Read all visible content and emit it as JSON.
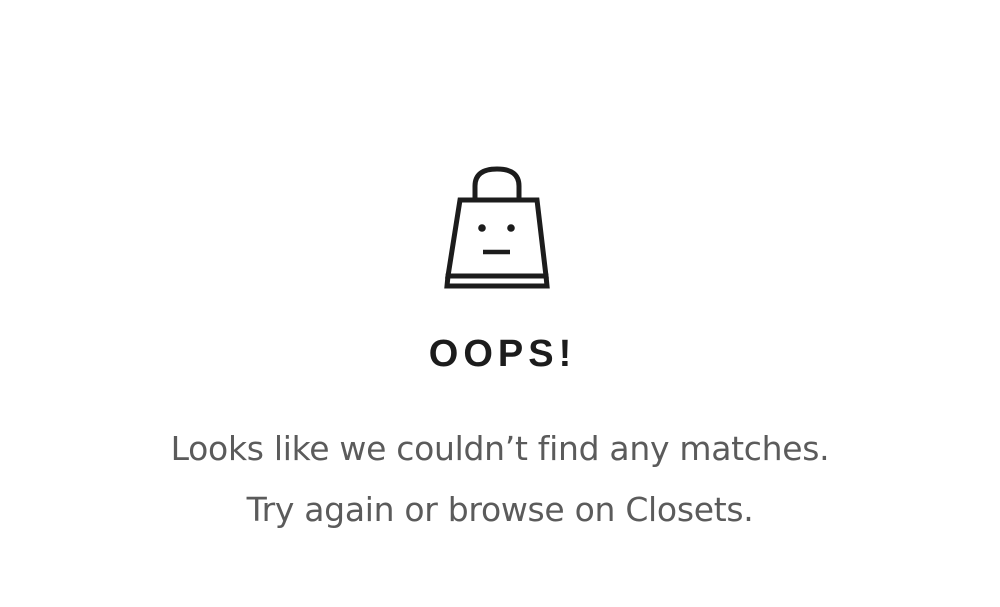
{
  "empty_state": {
    "icon": "shopping-bag-face-icon",
    "title": "OOPS!",
    "message_line1": "Looks like we couldn’t find any matches.",
    "message_line2": "Try again or browse on Closets."
  },
  "colors": {
    "background": "#ffffff",
    "icon_stroke": "#1c1c1c",
    "title": "#1c1c1c",
    "message": "#5b5b5b"
  }
}
